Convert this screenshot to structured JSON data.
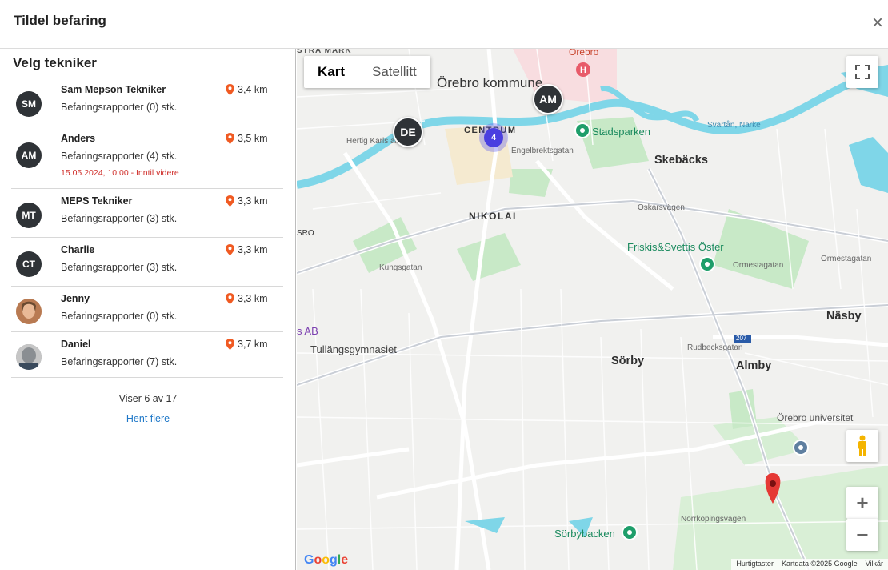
{
  "modal": {
    "title": "Tildel befaring",
    "close_symbol": "×"
  },
  "panel": {
    "title": "Velg tekniker",
    "technicians": [
      {
        "initials": "SM",
        "name": "Sam Mepson Tekniker",
        "reports": "Befaringsrapporter (0) stk.",
        "distance": "3,4 km",
        "note": ""
      },
      {
        "initials": "AM",
        "name": "Anders",
        "reports": "Befaringsrapporter (4) stk.",
        "distance": "3,5 km",
        "note": "15.05.2024, 10:00 - Inntil videre"
      },
      {
        "initials": "MT",
        "name": "MEPS Tekniker",
        "reports": "Befaringsrapporter (3) stk.",
        "distance": "3,3 km",
        "note": ""
      },
      {
        "initials": "CT",
        "name": "Charlie",
        "reports": "Befaringsrapporter (3) stk.",
        "distance": "3,3 km",
        "note": ""
      },
      {
        "initials": "",
        "name": "Jenny",
        "reports": "Befaringsrapporter (0) stk.",
        "distance": "3,3 km",
        "note": ""
      },
      {
        "initials": "",
        "name": "Daniel",
        "reports": "Befaringsrapporter (7) stk.",
        "distance": "3,7 km",
        "note": ""
      }
    ],
    "showing": "Viser 6 av 17",
    "load_more": "Hent flere"
  },
  "map": {
    "map_type": {
      "map": "Kart",
      "satellite": "Satellitt"
    },
    "labels": {
      "city": "Örebro kommune",
      "centrum": "CENTRUM",
      "nikolai": "NIKOLAI",
      "skebacks": "Skebäcks",
      "stadsparken": "Stadsparken",
      "friskis": "Friskis&Svettis Öster",
      "ormestagatan1": "Ormestagatan",
      "ormestagatan2": "Ormestagatan",
      "nasby": "Näsby",
      "sorby": "Sörby",
      "almby": "Almby",
      "universitet": "Örebro universitet",
      "sorbybacken": "Sörbybacken",
      "tullangs": "Tullängsgymnasiet",
      "ab": "s AB",
      "kungsgatan": "Kungsgatan",
      "oskarsvagen": "Oskarsvägen",
      "engelbrekts": "Engelbrektsgatan",
      "hertig": "Hertig Karls allé",
      "svartan": "Svartån, Närke",
      "rudbecks": "Rudbecksgatan",
      "norrkopings": "Norrköpingsvägen",
      "stra_mark": "STRA MARK",
      "orebro_red": "Orebro",
      "sro": "SRO",
      "road_207": "207"
    },
    "markers": {
      "de": "DE",
      "am": "AM",
      "cluster_count": "4"
    },
    "footer": {
      "shortcuts": "Hurtigtaster",
      "mapdata": "Kartdata ©2025 Google",
      "terms": "Vilkår"
    },
    "google": "Google"
  },
  "colors": {
    "avatar": "#2f3337",
    "accent_link": "#1f78c8",
    "note_red": "#d0312d",
    "pin_orange": "#f05a22",
    "water": "#7ed8e8",
    "park": "#c5e8c5"
  }
}
